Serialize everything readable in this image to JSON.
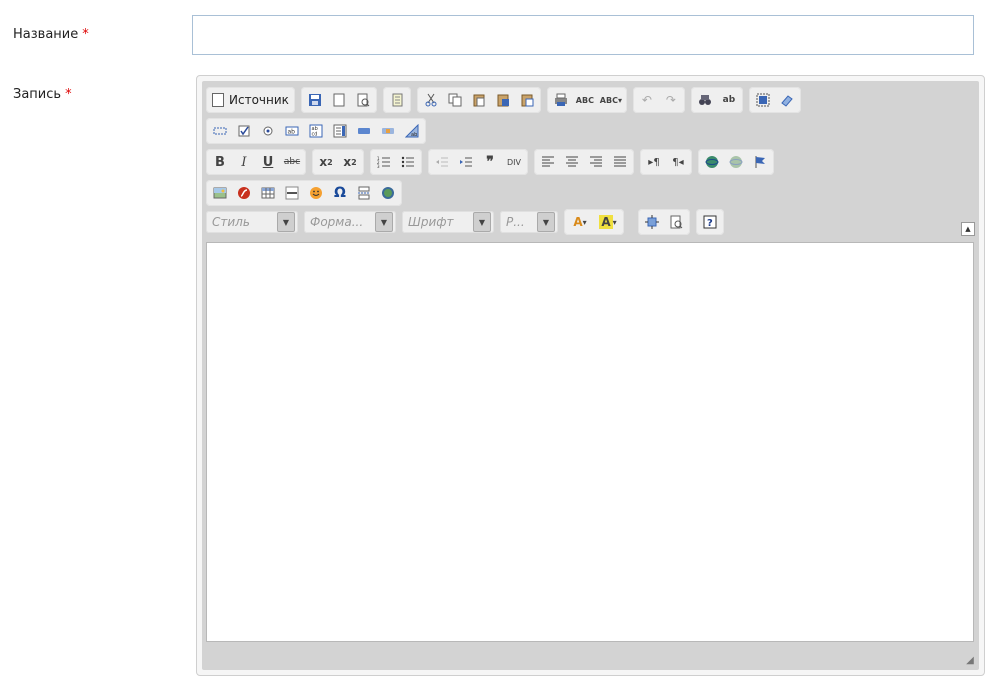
{
  "form": {
    "name_label": "Название",
    "entry_label": "Запись",
    "required_mark": "*",
    "name_value": "",
    "name_placeholder": ""
  },
  "editor": {
    "source_label": "Источник",
    "combos": {
      "style": "Стиль",
      "format": "Форма...",
      "font": "Шрифт",
      "size": "Р..."
    },
    "icons": {
      "row1": [
        "save-icon",
        "new-page-icon",
        "preview-icon",
        "templates-icon",
        "cut-icon",
        "copy-icon",
        "paste-icon",
        "paste-text-icon",
        "paste-word-icon",
        "print-icon",
        "spellcheck-icon",
        "spellcheck-auto-icon",
        "undo-icon",
        "redo-icon",
        "find-icon",
        "replace-icon",
        "select-all-icon",
        "remove-format-icon"
      ],
      "row2": [
        "form-icon",
        "checkbox-icon",
        "radio-icon",
        "textfield-icon",
        "textarea-icon",
        "select-icon",
        "button-icon",
        "image-button-icon",
        "hidden-field-icon"
      ],
      "row3": [
        "bold-icon",
        "italic-icon",
        "underline-icon",
        "strike-icon",
        "subscript-icon",
        "superscript-icon",
        "numbered-list-icon",
        "bulleted-list-icon",
        "outdent-icon",
        "indent-icon",
        "blockquote-icon",
        "div-icon",
        "align-left-icon",
        "align-center-icon",
        "align-right-icon",
        "justify-icon",
        "ltr-icon",
        "rtl-icon",
        "link-icon",
        "unlink-icon",
        "anchor-icon"
      ],
      "row4": [
        "image-icon",
        "flash-icon",
        "table-icon",
        "horizontal-rule-icon",
        "smiley-icon",
        "special-char-icon",
        "page-break-icon",
        "iframe-icon"
      ],
      "row5": [
        "text-color-icon",
        "bg-color-icon",
        "maximize-icon",
        "show-blocks-icon",
        "about-icon"
      ]
    }
  }
}
